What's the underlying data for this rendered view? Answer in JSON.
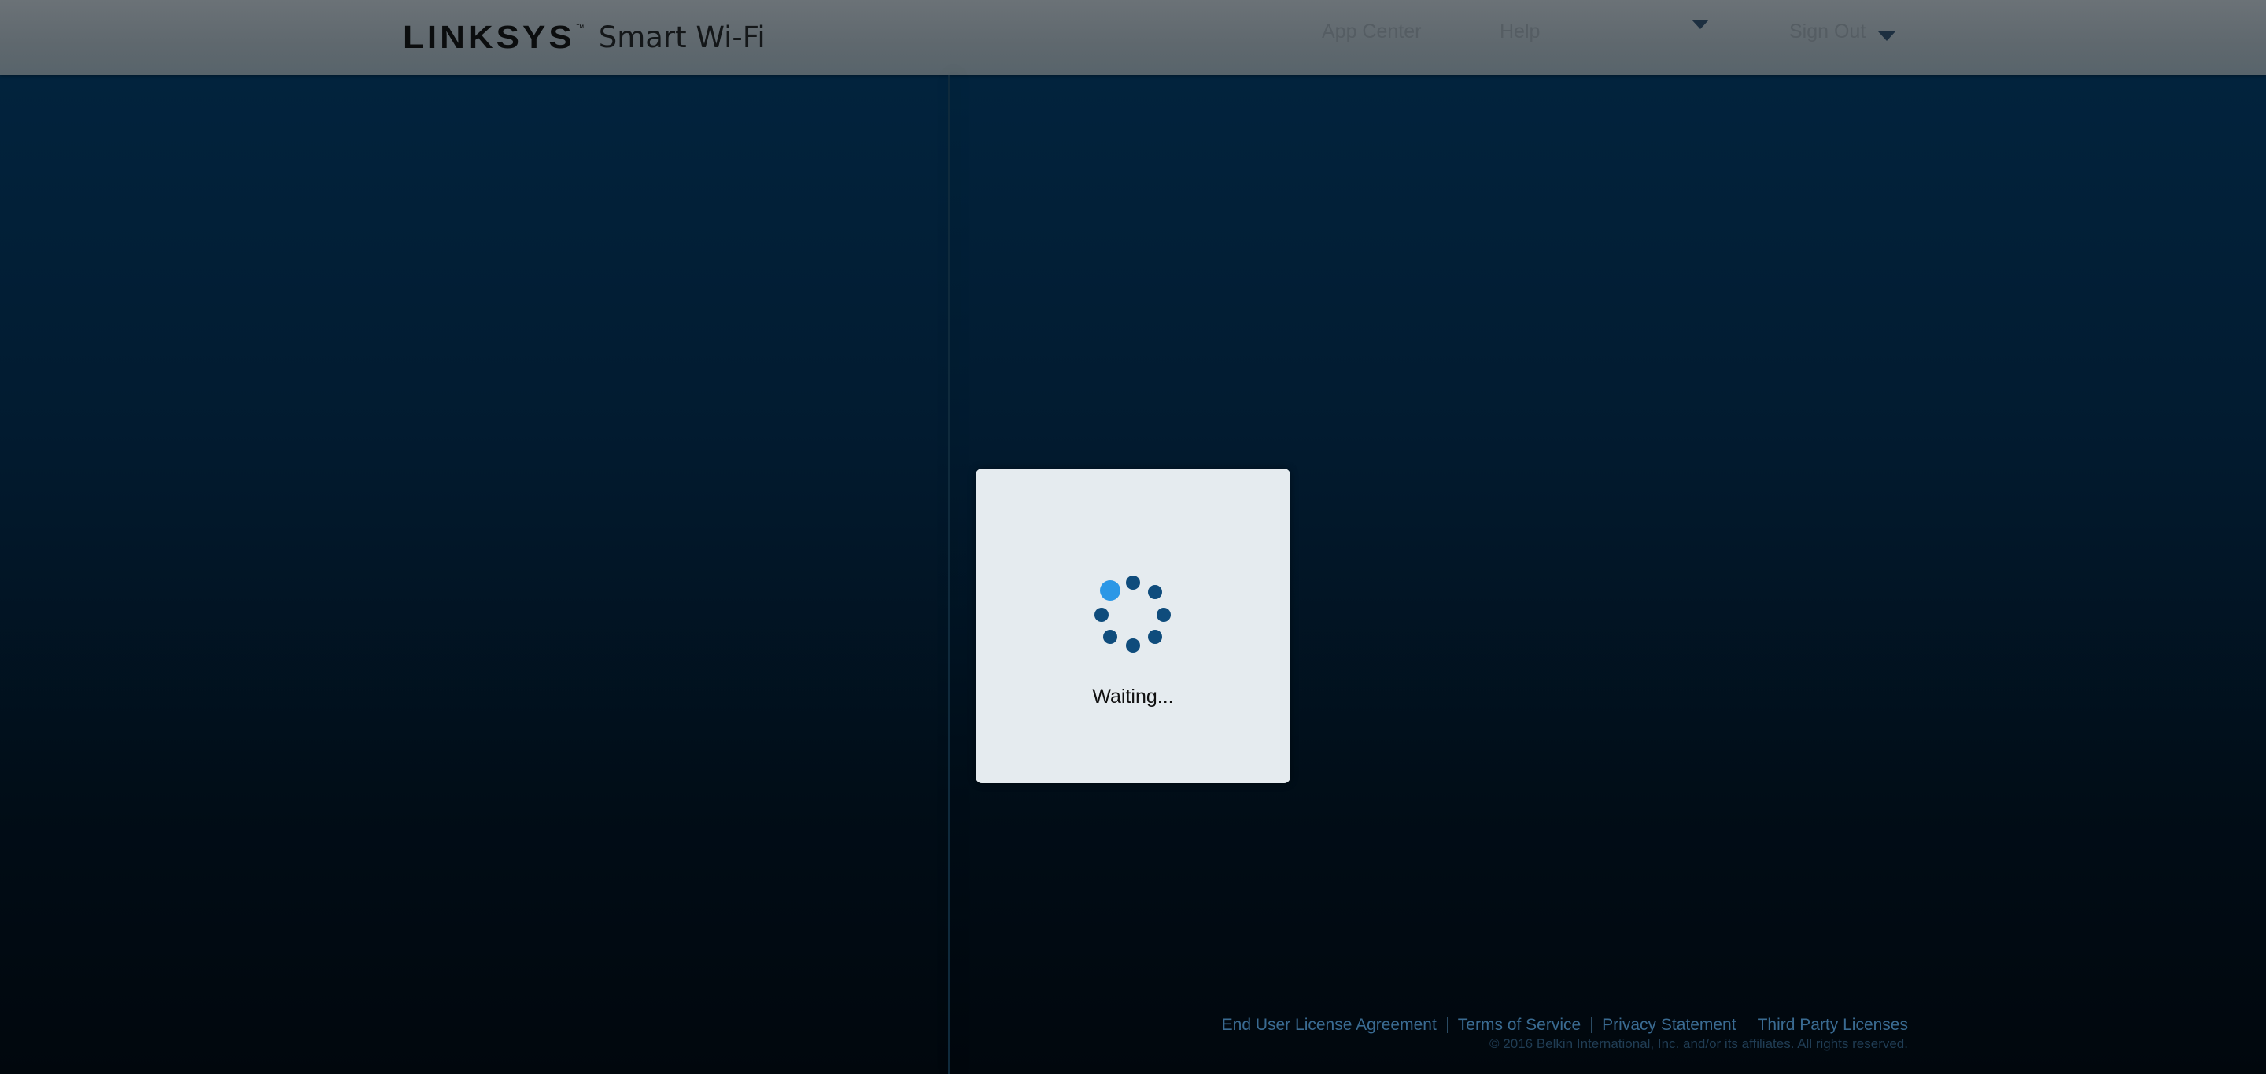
{
  "header": {
    "logo_brand": "LINKSYS",
    "logo_tm": "™",
    "logo_product": "Smart Wi-Fi",
    "nav": {
      "app_center": "App Center",
      "help": "Help",
      "sign_out": "Sign Out"
    }
  },
  "modal": {
    "status_text": "Waiting...",
    "spinner_active_color": "#2b97e6",
    "spinner_dot_color": "#0f4c7c"
  },
  "footer": {
    "links": [
      "End User License Agreement",
      "Terms of Service",
      "Privacy Statement",
      "Third Party Licenses"
    ],
    "copyright": "© 2016 Belkin International, Inc. and/or its affiliates. All rights reserved."
  },
  "colors": {
    "background_top": "#022540",
    "background_bottom": "#01070d",
    "footer_link": "#3a6b92"
  },
  "icons": {
    "spinner": "loading-spinner-icon",
    "caret": "caret-down-icon"
  }
}
